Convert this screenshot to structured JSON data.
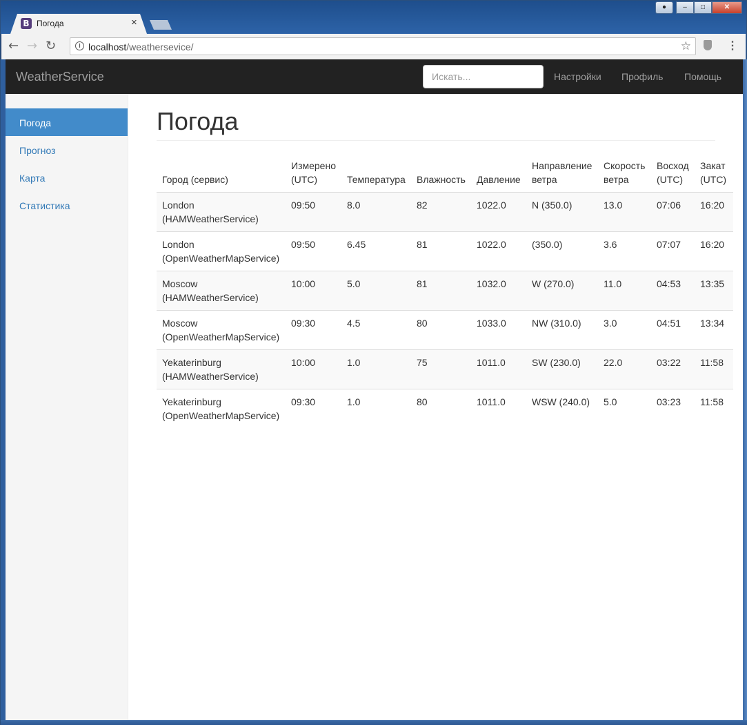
{
  "browser": {
    "tab_title": "Погода",
    "tab_favicon": "B",
    "tab_close": "×",
    "url_host": "localhost",
    "url_path": "/weathersevice/",
    "icons": {
      "back": "back-arrow-icon",
      "forward": "forward-arrow-icon",
      "reload": "reload-icon",
      "info": "info-icon",
      "star": "star-icon",
      "extension": "shield-extension-icon",
      "menu": "kebab-menu-icon"
    }
  },
  "navbar": {
    "brand": "WeatherService",
    "search_placeholder": "Искать...",
    "links": [
      "Настройки",
      "Профиль",
      "Помощь"
    ]
  },
  "sidebar": {
    "items": [
      {
        "label": "Погода",
        "active": true
      },
      {
        "label": "Прогноз",
        "active": false
      },
      {
        "label": "Карта",
        "active": false
      },
      {
        "label": "Статистика",
        "active": false
      }
    ]
  },
  "main": {
    "title": "Погода",
    "table": {
      "headers": [
        [
          "Город (сервис)"
        ],
        [
          "Измерено",
          "(UTC)"
        ],
        [
          "Температура"
        ],
        [
          "Влажность"
        ],
        [
          "Давление"
        ],
        [
          "Направление",
          "ветра"
        ],
        [
          "Скорость",
          "ветра"
        ],
        [
          "Восход",
          "(UTC)"
        ],
        [
          "Закат",
          "(UTC)"
        ]
      ],
      "rows": [
        {
          "city": "London",
          "service": "(HAMWeatherService)",
          "measured": "09:50",
          "temperature": "8.0",
          "humidity": "82",
          "pressure": "1022.0",
          "wind_dir": "N (350.0)",
          "wind_speed": "13.0",
          "sunrise": "07:06",
          "sunset": "16:20"
        },
        {
          "city": "London",
          "service": "(OpenWeatherMapService)",
          "measured": "09:50",
          "temperature": "6.45",
          "humidity": "81",
          "pressure": "1022.0",
          "wind_dir": "(350.0)",
          "wind_speed": "3.6",
          "sunrise": "07:07",
          "sunset": "16:20"
        },
        {
          "city": "Moscow",
          "service": "(HAMWeatherService)",
          "measured": "10:00",
          "temperature": "5.0",
          "humidity": "81",
          "pressure": "1032.0",
          "wind_dir": "W (270.0)",
          "wind_speed": "11.0",
          "sunrise": "04:53",
          "sunset": "13:35"
        },
        {
          "city": "Moscow",
          "service": "(OpenWeatherMapService)",
          "measured": "09:30",
          "temperature": "4.5",
          "humidity": "80",
          "pressure": "1033.0",
          "wind_dir": "NW (310.0)",
          "wind_speed": "3.0",
          "sunrise": "04:51",
          "sunset": "13:34"
        },
        {
          "city": "Yekaterinburg",
          "service": "(HAMWeatherService)",
          "measured": "10:00",
          "temperature": "1.0",
          "humidity": "75",
          "pressure": "1011.0",
          "wind_dir": "SW (230.0)",
          "wind_speed": "22.0",
          "sunrise": "03:22",
          "sunset": "11:58"
        },
        {
          "city": "Yekaterinburg",
          "service": "(OpenWeatherMapService)",
          "measured": "09:30",
          "temperature": "1.0",
          "humidity": "80",
          "pressure": "1011.0",
          "wind_dir": "WSW (240.0)",
          "wind_speed": "5.0",
          "sunrise": "03:23",
          "sunset": "11:58"
        }
      ]
    }
  },
  "colors": {
    "navbar_bg": "#222222",
    "sidebar_active": "#428bca",
    "link": "#337ab7"
  }
}
